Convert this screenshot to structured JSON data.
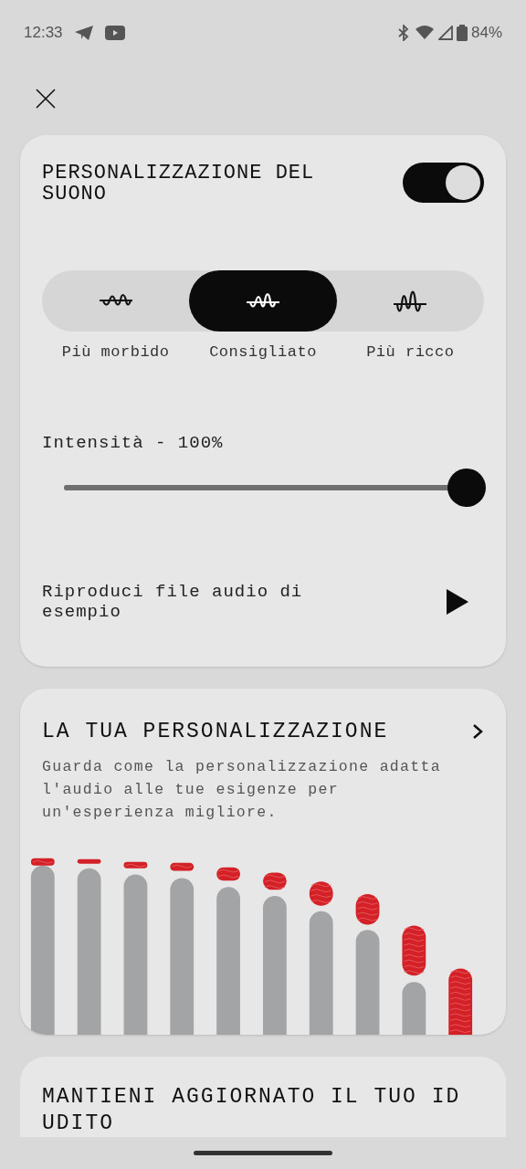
{
  "status_bar": {
    "time": "12:33",
    "battery": "84%"
  },
  "sound_card": {
    "title": "PERSONALIZZAZIONE DEL SUONO",
    "enabled": true,
    "presets": [
      {
        "label": "Più morbido",
        "kind": "soft",
        "selected": false
      },
      {
        "label": "Consigliato",
        "kind": "medium",
        "selected": true
      },
      {
        "label": "Più ricco",
        "kind": "rich",
        "selected": false
      }
    ],
    "intensity": {
      "label": "Intensità - 100%",
      "level": 1
    },
    "sample": {
      "label": "Riproduci file audio di esempio"
    }
  },
  "profile_card": {
    "title": "LA TUA PERSONALIZZAZIONE",
    "description": "Guarda come la personalizzazione adatta l'audio alle tue esigenze per un'esperienza migliore."
  },
  "update_card": {
    "title": "MANTIENI AGGIORNATO IL TUO ID UDITO"
  }
}
